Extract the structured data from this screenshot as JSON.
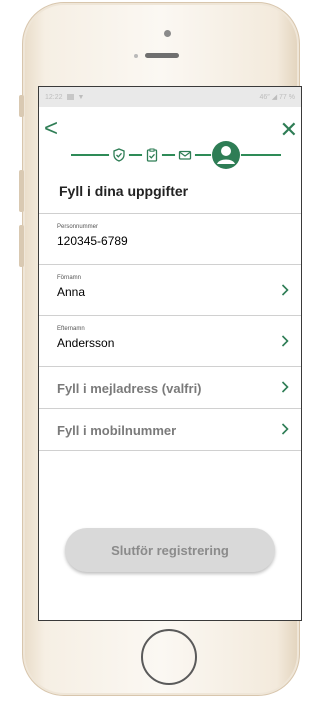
{
  "status": {
    "time": "12:22",
    "right": "46″ ◢ 77 %"
  },
  "nav": {
    "back": "<",
    "close": "✕"
  },
  "progress": {
    "total_steps": 4,
    "current_step": 4
  },
  "page": {
    "title": "Fyll i dina uppgifter"
  },
  "fields": {
    "personnummer": {
      "label": "Personnummer",
      "value": "120345-6789"
    },
    "fornamn": {
      "label": "Förnamn",
      "value": "Anna"
    },
    "efternamn": {
      "label": "Efternamn",
      "value": "Andersson"
    },
    "email": {
      "placeholder": "Fyll i mejladress (valfri)"
    },
    "mobile": {
      "placeholder": "Fyll i mobilnummer"
    }
  },
  "submit": {
    "label": "Slutför registrering"
  },
  "colors": {
    "accent": "#2e7d55",
    "disabled_button": "#d9d9d9"
  }
}
